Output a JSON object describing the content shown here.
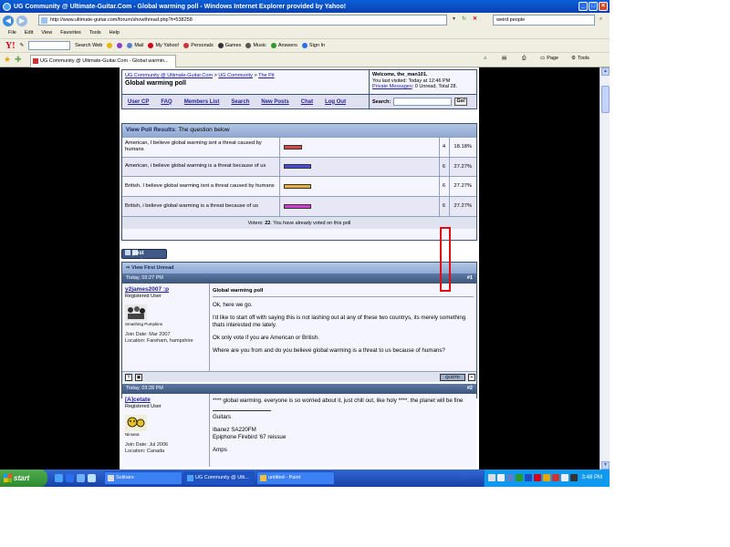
{
  "window": {
    "title": "UG Community @ Ultimate-Guitar.Com - Global warming poll - Windows Internet Explorer provided by Yahoo!",
    "address": "http://www.ultimate-guitar.com/forum/showthread.php?t=538258",
    "search_value": "weird people"
  },
  "menu": [
    "File",
    "Edit",
    "View",
    "Favorites",
    "Tools",
    "Help"
  ],
  "yahoo_toolbar": {
    "search_web": "Search Web",
    "items": [
      "Mail",
      "My Yahoo!",
      "Personals",
      "Games",
      "Music",
      "Answers",
      "Sign In"
    ]
  },
  "tab": {
    "title": "UG Community @ Ultimate-Guitar.Com - Global warmin...",
    "page_menu": "Page",
    "tools_menu": "Tools"
  },
  "forum": {
    "breadcrumb": [
      "UG Community @ Ultimate-Guitar.Com",
      "UG Community",
      "The Pit"
    ],
    "thread_title": "Global warming poll",
    "welcome": "Welcome, the_man101.",
    "last_visited": "You last visited: Today at 12:46 PM",
    "private_messages_link": "Private Messages",
    "private_messages_rest": ": 0 Unread, Total 28.",
    "nav": [
      "User CP",
      "FAQ",
      "Members List",
      "Search",
      "New Posts",
      "Chat",
      "Log Out"
    ],
    "search_label": "Search:",
    "go_label": "Go!"
  },
  "poll": {
    "header_bold": "View Poll Results",
    "header_rest": ": The question below",
    "options": [
      {
        "text": "American, I believe global warming isnt a threat caused by humans",
        "count": "4",
        "percent": "18.18%",
        "value": 18.18,
        "color": "#d84a4a"
      },
      {
        "text": "American, i believe global warming is a threat because of us",
        "count": "6",
        "percent": "27.27%",
        "value": 27.27,
        "color": "#4a4ad8"
      },
      {
        "text": "British, I believe global warming isnt a threat caused by humans",
        "count": "6",
        "percent": "27.27%",
        "value": 27.27,
        "color": "#e8b040"
      },
      {
        "text": "British, i believe global warming is a threat because of us",
        "count": "6",
        "percent": "27.27%",
        "value": 27.27,
        "color": "#d040d0"
      }
    ],
    "voters_label": "Voters",
    "voters_count": "22",
    "voters_rest": ". You have already voted on this poll"
  },
  "post_reply_label": "post reply",
  "view_first_unread": "View First Unread",
  "posts": [
    {
      "time": "Today, 03:27 PM",
      "number": "#1",
      "username": "y2james2007 :p",
      "rank": "Registered User",
      "avatar_label": "Smashing Pumpkins",
      "join_date": "Join Date: Mar 2007",
      "location": "Location: Fareham, hampshire",
      "title": "Global warming poll",
      "paragraphs": [
        "Ok, here we go.",
        "I'd like to start off with saying this is not lashing out at any of these two countrys, its merely something thats interested me lately.",
        "Ok only vote if you are American or British.",
        "Where are you from and do you believe global warming is a threat to us because of humans?"
      ]
    },
    {
      "time": "Today, 03:28 PM",
      "number": "#2",
      "username": "[A]cetate",
      "rank": "Registered User",
      "avatar_label": "Nirvana",
      "join_date": "Join Date: Jul 2006",
      "location": "Location: Canada",
      "body": "**** global warming. everyone is so worried about it, just chill out, like holy ****. the planet will be fine",
      "sig_heading": "Guitars",
      "sig_lines": [
        "Ibanez SA220FM",
        "Epiphone Firebird '67 reissue"
      ],
      "sig_amps": "Amps"
    }
  ],
  "taskbar": {
    "start": "start",
    "tasks": [
      "Solitaire",
      "UG Community @ Ulti...",
      "untitled - Paint"
    ],
    "clock": "3:48 PM"
  }
}
